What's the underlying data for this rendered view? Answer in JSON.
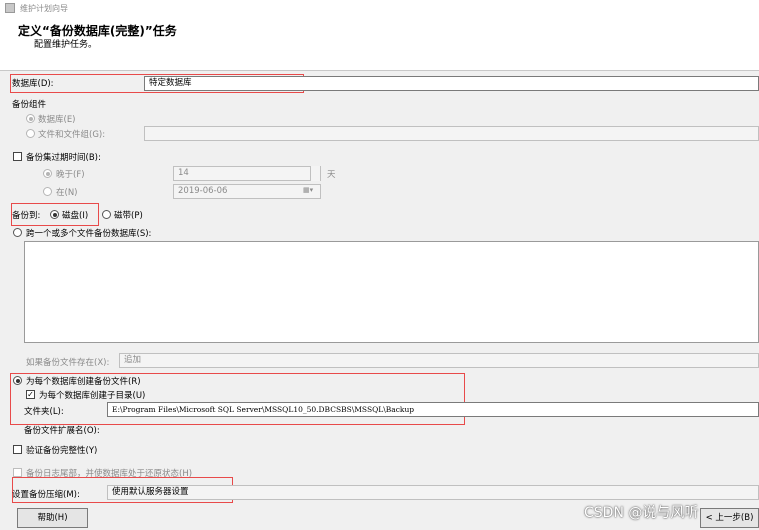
{
  "window": {
    "title": "维护计划向导"
  },
  "header": {
    "title": "定义“备份数据库(完整)”任务",
    "subtitle": "配置维护任务。"
  },
  "database": {
    "label": "数据库(D):",
    "value": "特定数据库"
  },
  "backup_component": {
    "label": "备份组件",
    "database_option": "数据库(E)",
    "files_option": "文件和文件组(G):"
  },
  "expire": {
    "checkbox_label": "备份集过期时间(B):",
    "after_label": "晚于(F)",
    "after_value": "14",
    "days_unit": "天",
    "on_label": "在(N)",
    "on_value": "2019-06-06"
  },
  "backup_to": {
    "label": "备份到:",
    "disk": "磁盘(I)",
    "tape": "磁带(P)"
  },
  "span": {
    "label": "跨一个或多个文件备份数据库(S):"
  },
  "if_exists": {
    "label": "如果备份文件存在(X):",
    "value": "追加"
  },
  "per_db": {
    "radio_label": "为每个数据库创建备份文件(R)",
    "subdir_label": "为每个数据库创建子目录(U)",
    "folder_label": "文件夹(L):",
    "folder_value": "E:\\Program Files\\Microsoft SQL Server\\MSSQL10_50.DBCSBS\\MSSQL\\Backup",
    "ext_label": "备份文件扩展名(O):"
  },
  "verify": {
    "label": "验证备份完整性(Y)"
  },
  "tail_log": {
    "label": "备份日志尾部，并使数据库处于还原状态(H)"
  },
  "compression": {
    "label": "设置备份压缩(M):",
    "value": "使用默认服务器设置"
  },
  "buttons": {
    "help": "帮助(H)",
    "prev": "< 上一步(B)"
  },
  "watermark": "CSDN @说与风听",
  "colors": {
    "highlight_box": "#e84a4a",
    "window_bg": "#f0f0f0"
  }
}
